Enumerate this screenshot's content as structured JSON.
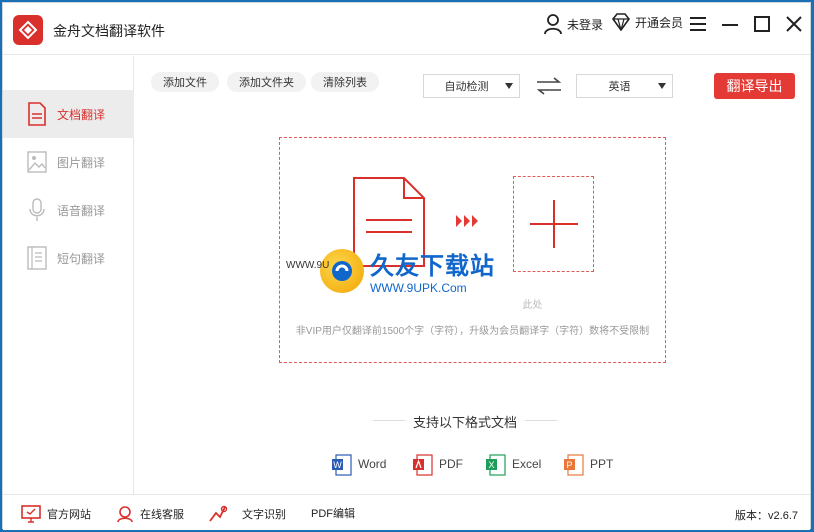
{
  "app": {
    "title": "金舟文档翻译软件"
  },
  "titlebar": {
    "login": "未登录",
    "vip": "开通会员"
  },
  "sidebar": {
    "items": [
      {
        "label": "文档翻译",
        "icon": "document-icon",
        "active": true
      },
      {
        "label": "图片翻译",
        "icon": "image-icon",
        "active": false
      },
      {
        "label": "语音翻译",
        "icon": "microphone-icon",
        "active": false
      },
      {
        "label": "短句翻译",
        "icon": "text-lines-icon",
        "active": false
      }
    ]
  },
  "toolbar": {
    "add_file": "添加文件",
    "add_folder": "添加文件夹",
    "clear_list": "清除列表",
    "source_lang": "自动检测",
    "target_lang": "英语",
    "export": "翻译导出"
  },
  "dropzone": {
    "hint": "此处",
    "limit": "非VIP用户仅翻译前1500个字（字符），升级为会员翻译字（字符）数将不受限制"
  },
  "watermark": {
    "title": "久友下载站",
    "url": "WWW.9UPK.Com",
    "left": "WWW.9U"
  },
  "formats": {
    "title": "支持以下格式文档",
    "items": [
      {
        "label": "Word",
        "color": "#2b5bb5",
        "letter": "W"
      },
      {
        "label": "PDF",
        "color": "#d9302c",
        "letter": "A"
      },
      {
        "label": "Excel",
        "color": "#1e9e5a",
        "letter": "X"
      },
      {
        "label": "PPT",
        "color": "#e9773a",
        "letter": "P"
      }
    ]
  },
  "footer": {
    "website": "官方网站",
    "service": "在线客服",
    "ocr": "文字识别",
    "pdf_edit": "PDF编辑",
    "version": "版本：v2.6.7"
  },
  "colors": {
    "accent": "#e43a36",
    "active_bg": "#ececec"
  }
}
